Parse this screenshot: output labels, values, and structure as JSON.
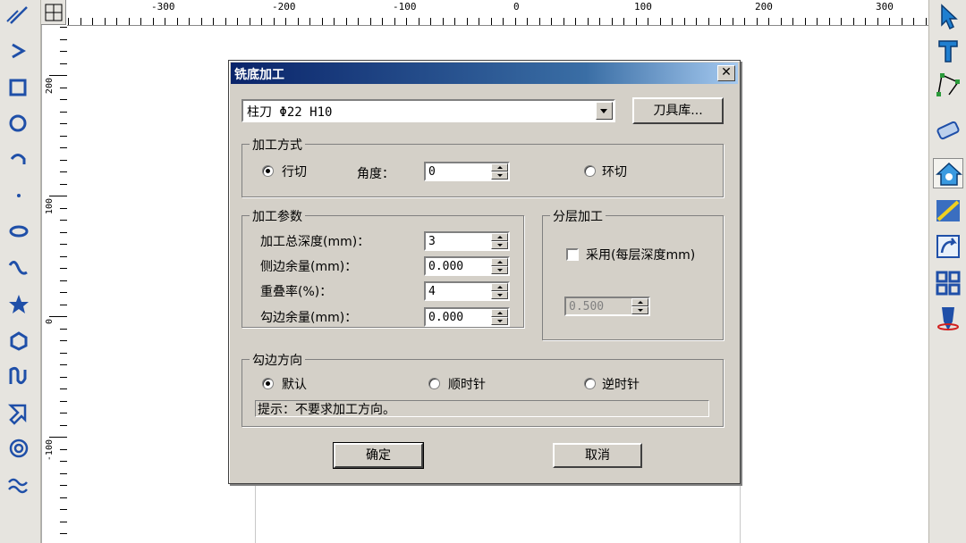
{
  "ruler": {
    "h_labels": [
      "-300",
      "-200",
      "-100",
      "0",
      "100",
      "200",
      "300"
    ],
    "v_labels": [
      "200",
      "100",
      "0",
      "-100"
    ]
  },
  "left_toolbar_icons": [
    "line-icon",
    "polyline-icon",
    "rectangle-icon",
    "circle-icon",
    "arc-icon",
    "point-icon",
    "ellipse-icon",
    "spline-icon",
    "star-icon",
    "polygon-icon",
    "text-curve-icon",
    "arrow-shape-icon",
    "spiral-icon",
    "wave-icon"
  ],
  "right_toolbar_icons": [
    "select-arrow-icon",
    "text-tool-icon",
    "node-edit-icon",
    "eraser-icon",
    "relief-icon",
    "toolpath-icon",
    "transform-icon",
    "grid-icon",
    "cutter-icon"
  ],
  "dialog": {
    "title": "铣底加工",
    "close": "✕",
    "tool_select": {
      "value": "柱刀 Φ22 H10"
    },
    "tool_library_button": "刀具库...",
    "method_group": {
      "title": "加工方式",
      "row_cut_label": "行切",
      "angle_label": "角度：",
      "angle_value": "0",
      "ring_cut_label": "环切",
      "selected": "row_cut"
    },
    "params_group": {
      "title": "加工参数",
      "total_depth_label": "加工总深度(mm)：",
      "total_depth_value": "3",
      "side_allowance_label": "侧边余量(mm)：",
      "side_allowance_value": "0.000",
      "overlap_label": "重叠率(%)：",
      "overlap_value": "4",
      "outline_allowance_label": "勾边余量(mm)：",
      "outline_allowance_value": "0.000"
    },
    "layer_group": {
      "title": "分层加工",
      "use_label": "采用(每层深度mm)",
      "use_checked": false,
      "layer_depth_value": "0.500"
    },
    "direction_group": {
      "title": "勾边方向",
      "default_label": "默认",
      "clockwise_label": "顺时针",
      "counter_label": "逆时针",
      "selected": "default",
      "hint": "提示：不要求加工方向。"
    },
    "ok_button": "确定",
    "cancel_button": "取消"
  },
  "colors": {
    "title_start": "#0a246a",
    "title_end": "#a6caf0",
    "dialog_face": "#d4d0c8",
    "toolbar_icon_blue": "#1f4fa8"
  }
}
